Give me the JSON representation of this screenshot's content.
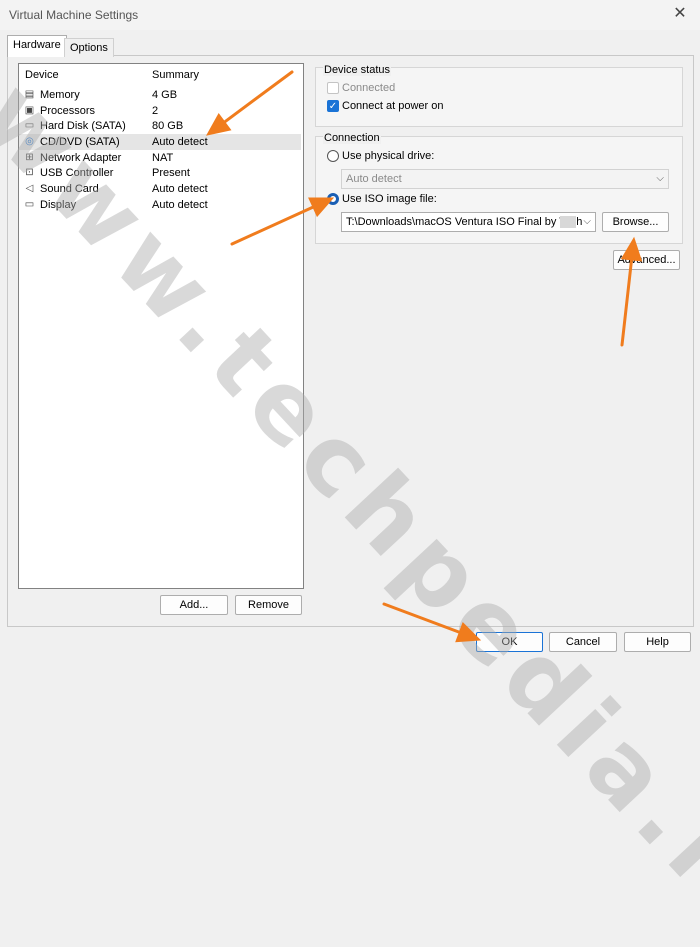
{
  "window": {
    "title": "Virtual Machine Settings",
    "close_glyph": "✕"
  },
  "tabs": [
    {
      "label": "Hardware"
    },
    {
      "label": "Options"
    }
  ],
  "device_list": {
    "headers": {
      "device": "Device",
      "summary": "Summary"
    },
    "rows": [
      {
        "icon": "memory-icon",
        "glyph": "▤",
        "name": "Memory",
        "summary": "4 GB"
      },
      {
        "icon": "processor-icon",
        "glyph": "▣",
        "name": "Processors",
        "summary": "2"
      },
      {
        "icon": "hard-disk-icon",
        "glyph": "▭",
        "name": "Hard Disk (SATA)",
        "summary": "80 GB"
      },
      {
        "icon": "cd-dvd-icon",
        "glyph": "◎",
        "name": "CD/DVD (SATA)",
        "summary": "Auto detect",
        "selected": true
      },
      {
        "icon": "network-adapter-icon",
        "glyph": "⊞",
        "name": "Network Adapter",
        "summary": "NAT"
      },
      {
        "icon": "usb-controller-icon",
        "glyph": "⊡",
        "name": "USB Controller",
        "summary": "Present"
      },
      {
        "icon": "sound-card-icon",
        "glyph": "◁",
        "name": "Sound Card",
        "summary": "Auto detect"
      },
      {
        "icon": "display-icon",
        "glyph": "▭",
        "name": "Display",
        "summary": "Auto detect"
      }
    ],
    "add_label": "Add...",
    "remove_label": "Remove"
  },
  "device_status": {
    "title": "Device status",
    "connected_label": "Connected",
    "connected_checked": false,
    "connected_enabled": false,
    "connect_power_label": "Connect at power on",
    "connect_power_checked": true
  },
  "connection": {
    "title": "Connection",
    "physical_label": "Use physical drive:",
    "physical_selected": false,
    "physical_value": "Auto detect",
    "iso_label": "Use ISO image file:",
    "iso_selected": true,
    "iso_value": "T:\\Downloads\\macOS Ventura ISO Final by Tech",
    "browse_label": "Browse...",
    "advanced_label": "Advanced..."
  },
  "footer": {
    "ok_label": "OK",
    "cancel_label": "Cancel",
    "help_label": "Help"
  },
  "watermark": "www.techpedia.it",
  "colors": {
    "arrow": "#f07c1d",
    "accent": "#1a73d6"
  }
}
